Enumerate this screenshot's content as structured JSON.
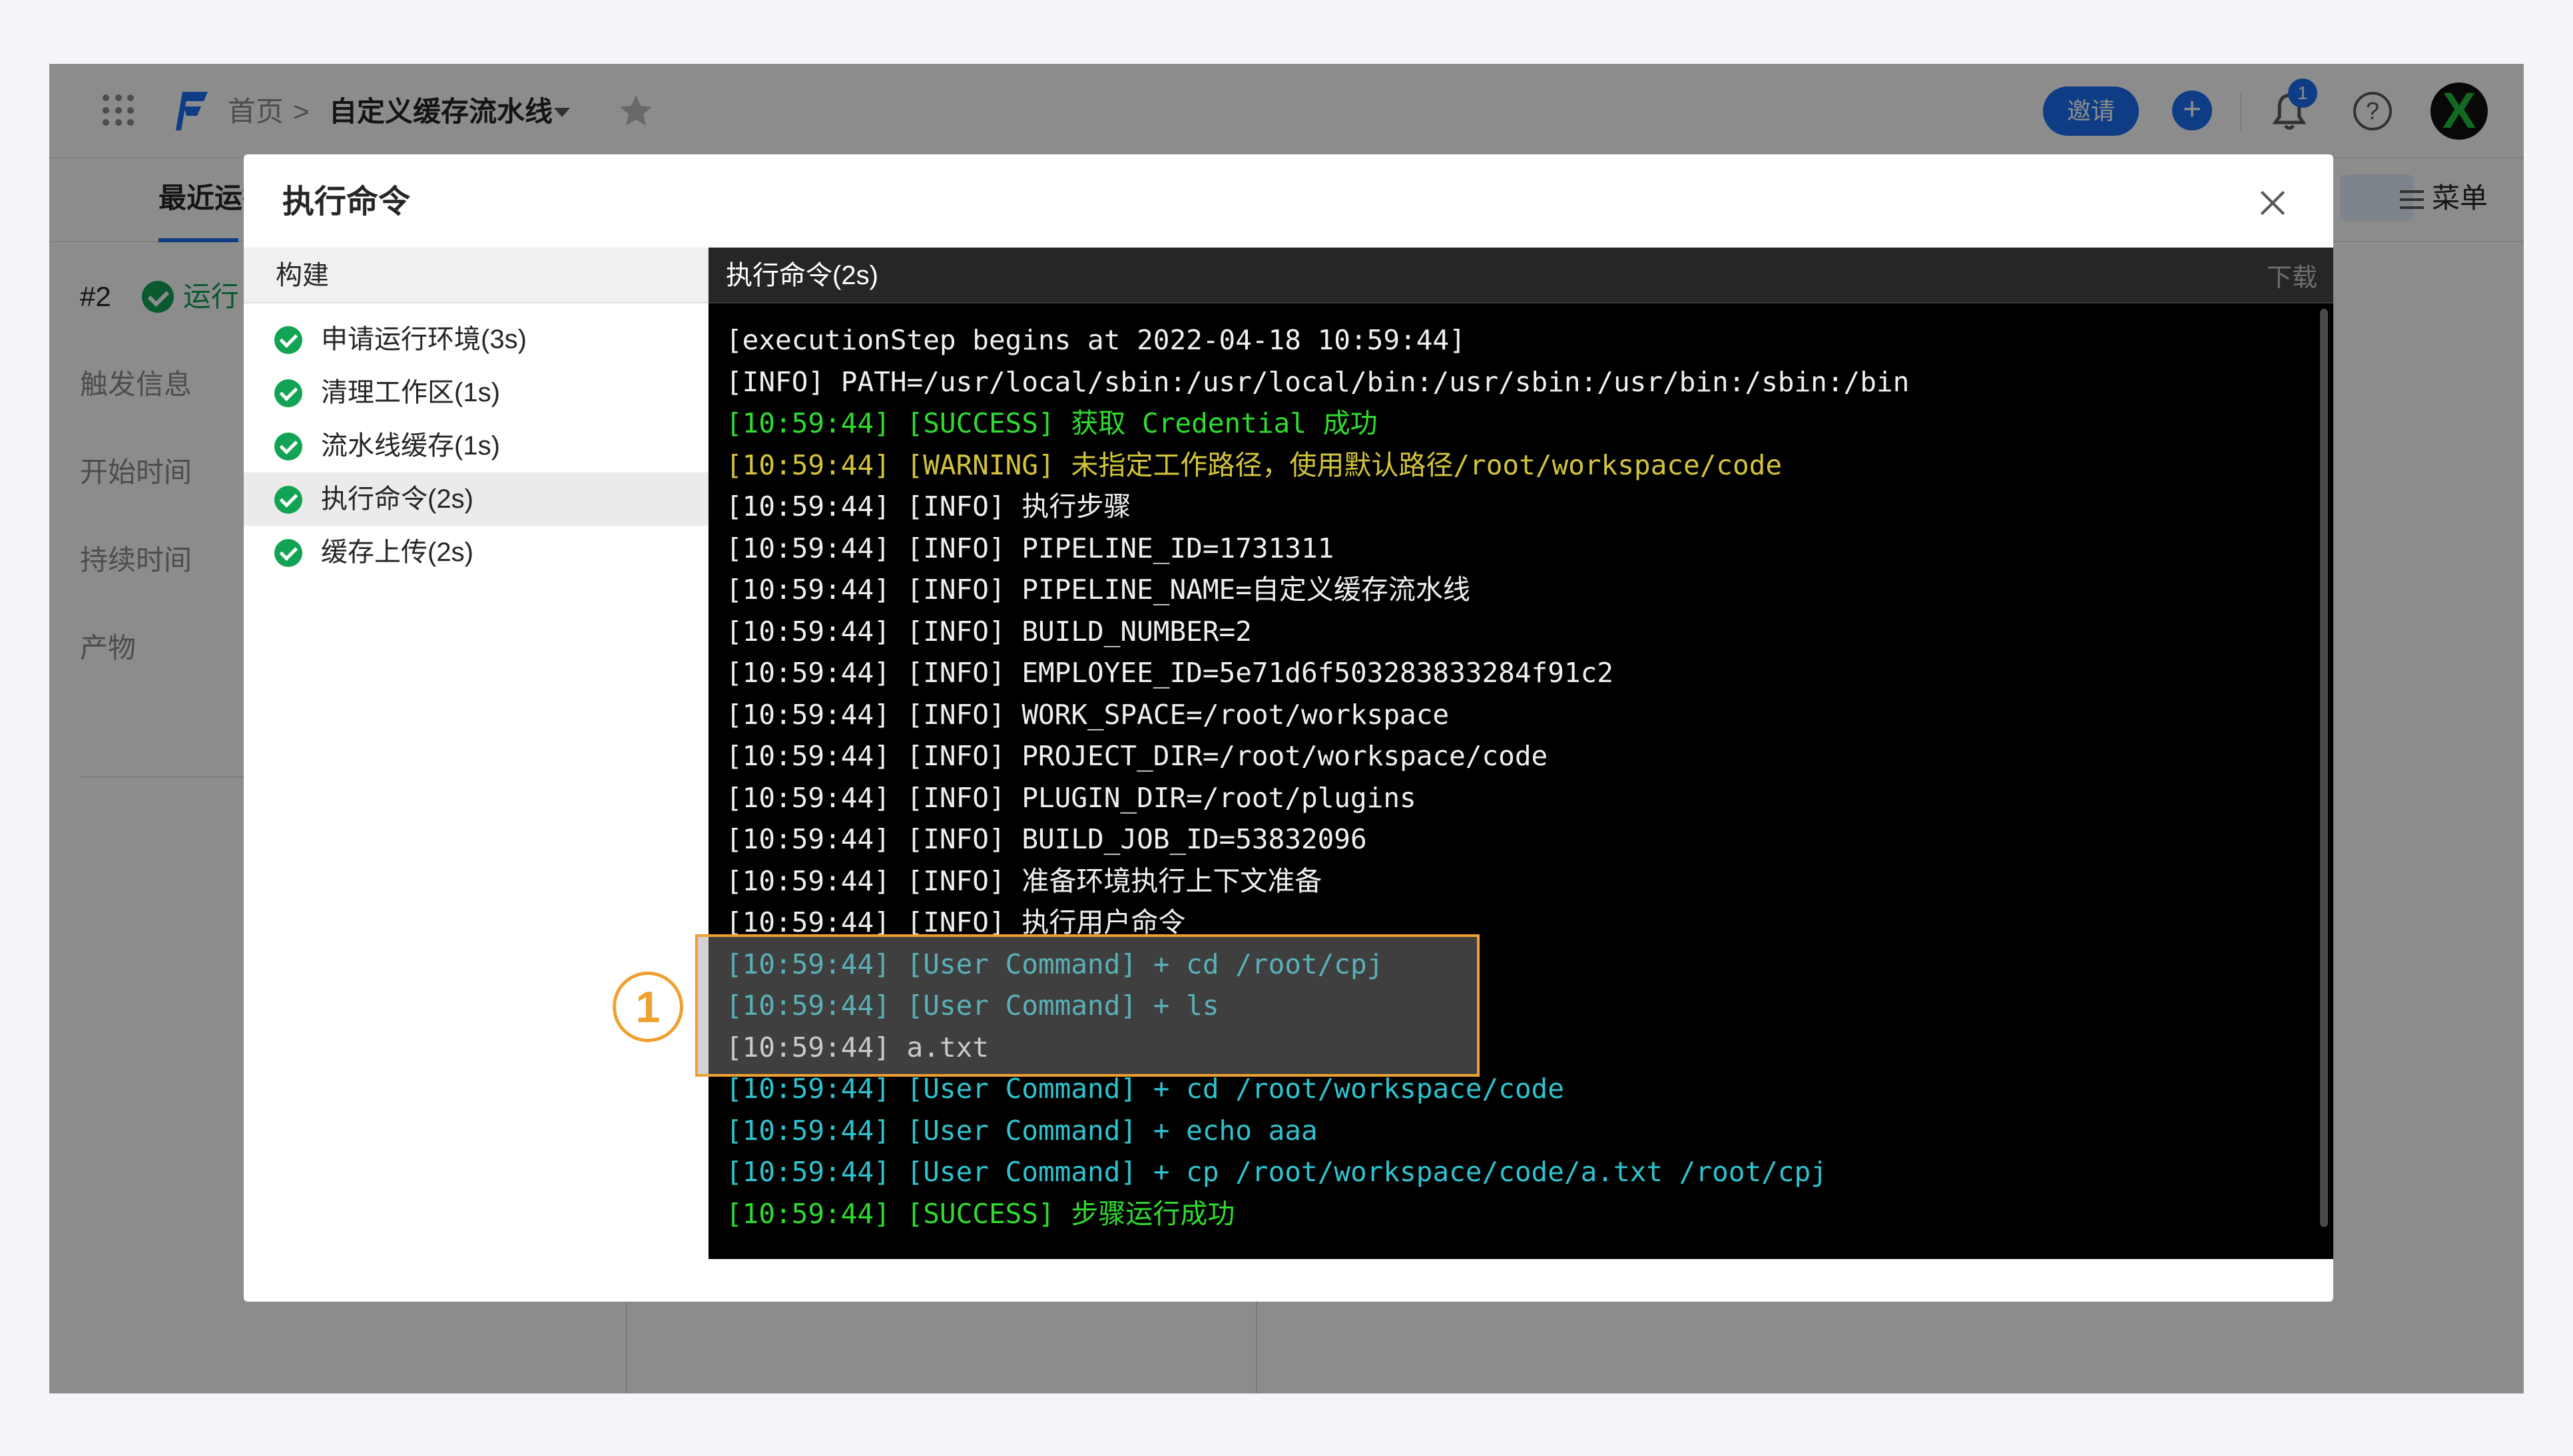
{
  "topbar": {
    "breadcrumb_home": "首页",
    "breadcrumb_separator": ">",
    "breadcrumb_current": "自定义缓存流水线",
    "invite_label": "邀请",
    "plus_label": "+",
    "notification_count": "1",
    "help_label": "?",
    "avatar_label": "X"
  },
  "subbar": {
    "tab_label": "最近运行",
    "menu_label": "菜单"
  },
  "left_info": {
    "run_number": "#2",
    "run_status": "运行",
    "labels": [
      "触发信息",
      "开始时间",
      "持续时间",
      "产物"
    ]
  },
  "modal": {
    "title": "执行命令",
    "steps_header": "构建",
    "steps": [
      {
        "label": "申请运行环境(3s)",
        "active": false
      },
      {
        "label": "清理工作区(1s)",
        "active": false
      },
      {
        "label": "流水线缓存(1s)",
        "active": false
      },
      {
        "label": "执行命令(2s)",
        "active": true
      },
      {
        "label": "缓存上传(2s)",
        "active": false
      }
    ],
    "console_title": "执行命令(2s)",
    "download_label": "下载",
    "logs": [
      {
        "text": "[executionStep begins at 2022-04-18 10:59:44]",
        "type": "normal"
      },
      {
        "text": "[INFO] PATH=/usr/local/sbin:/usr/local/bin:/usr/sbin:/usr/bin:/sbin:/bin",
        "type": "normal"
      },
      {
        "text": "[10:59:44] [SUCCESS] 获取 Credential 成功",
        "type": "success"
      },
      {
        "text": "[10:59:44] [WARNING] 未指定工作路径，使用默认路径/root/workspace/code",
        "type": "warning"
      },
      {
        "text": "[10:59:44] [INFO] 执行步骤",
        "type": "normal"
      },
      {
        "text": "[10:59:44] [INFO] PIPELINE_ID=1731311",
        "type": "normal"
      },
      {
        "text": "[10:59:44] [INFO] PIPELINE_NAME=自定义缓存流水线",
        "type": "normal"
      },
      {
        "text": "[10:59:44] [INFO] BUILD_NUMBER=2",
        "type": "normal"
      },
      {
        "text": "[10:59:44] [INFO] EMPLOYEE_ID=5e71d6f503283833284f91c2",
        "type": "normal"
      },
      {
        "text": "[10:59:44] [INFO] WORK_SPACE=/root/workspace",
        "type": "normal"
      },
      {
        "text": "[10:59:44] [INFO] PROJECT_DIR=/root/workspace/code",
        "type": "normal"
      },
      {
        "text": "[10:59:44] [INFO] PLUGIN_DIR=/root/plugins",
        "type": "normal"
      },
      {
        "text": "[10:59:44] [INFO] BUILD_JOB_ID=53832096",
        "type": "normal"
      },
      {
        "text": "[10:59:44] [INFO] 准备环境执行上下文准备",
        "type": "normal"
      },
      {
        "text": "[10:59:44] [INFO] 执行用户命令",
        "type": "normal"
      },
      {
        "text": "[10:59:44] [User Command] + cd /root/cpj",
        "type": "cmd"
      },
      {
        "text": "[10:59:44] [User Command] + ls",
        "type": "cmd"
      },
      {
        "text": "[10:59:44] a.txt",
        "type": "normal"
      },
      {
        "text": "[10:59:44] [User Command] + cd /root/workspace/code",
        "type": "cmd"
      },
      {
        "text": "[10:59:44] [User Command] + echo aaa",
        "type": "cmd"
      },
      {
        "text": "[10:59:44] [User Command] + cp /root/workspace/code/a.txt /root/cpj",
        "type": "cmd"
      },
      {
        "text": "[10:59:44] [SUCCESS] 步骤运行成功",
        "type": "success"
      }
    ]
  },
  "annotation": {
    "marker_label": "1"
  },
  "colors": {
    "brand_blue": "#1b6ef3",
    "success_green": "#12a454",
    "log_success": "#2fdb2f",
    "log_warning": "#d2c33a",
    "log_command": "#2fc3ce",
    "annotation_orange": "#f0a030"
  }
}
